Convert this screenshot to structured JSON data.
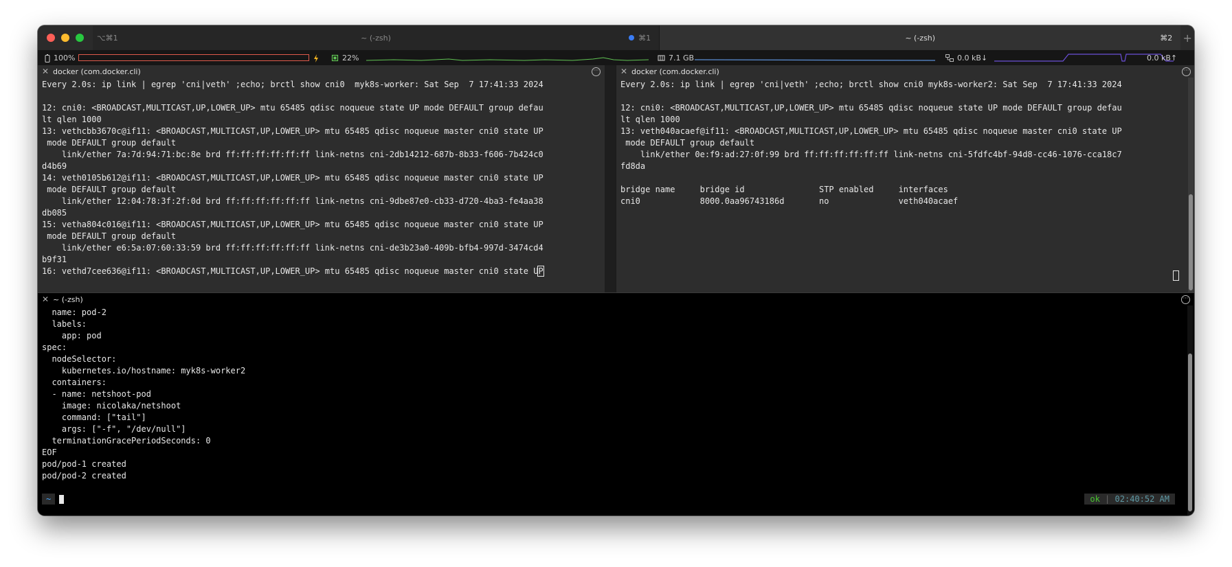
{
  "window": {
    "tabs": [
      {
        "shortcut_left": "⌥⌘1",
        "title": "~ (-zsh)",
        "shortcut_right": "⌘1"
      },
      {
        "title": "~ (-zsh)",
        "shortcut_right": "⌘2"
      }
    ],
    "new_tab": "+"
  },
  "status_bar": {
    "battery": "100%",
    "cpu": "22%",
    "memory": "7.1 GB",
    "net_down": "0.0 kB↓",
    "net_up": "0.0 kB↑",
    "colors": {
      "battery_bar": "#e05a4b",
      "cpu_graph": "#61c454",
      "mem_graph": "#5b8fd6",
      "net_graph": "#6b4fd8"
    }
  },
  "panes": {
    "worker": {
      "title": "docker (com.docker.cli)",
      "lines": [
        "Every 2.0s: ip link | egrep 'cni|veth' ;echo; brctl show cni0  myk8s-worker: Sat Sep  7 17:41:33 2024",
        "",
        "12: cni0: <BROADCAST,MULTICAST,UP,LOWER_UP> mtu 65485 qdisc noqueue state UP mode DEFAULT group defau",
        "lt qlen 1000",
        "13: vethcbb3670c@if11: <BROADCAST,MULTICAST,UP,LOWER_UP> mtu 65485 qdisc noqueue master cni0 state UP",
        " mode DEFAULT group default",
        "    link/ether 7a:7d:94:71:bc:8e brd ff:ff:ff:ff:ff:ff link-netns cni-2db14212-687b-8b33-f606-7b424c0",
        "d4b69",
        "14: veth0105b612@if11: <BROADCAST,MULTICAST,UP,LOWER_UP> mtu 65485 qdisc noqueue master cni0 state UP",
        " mode DEFAULT group default",
        "    link/ether 12:04:78:3f:2f:0d brd ff:ff:ff:ff:ff:ff link-netns cni-9dbe87e0-cb33-d720-4ba3-fe4aa38",
        "db085",
        "15: vetha804c016@if11: <BROADCAST,MULTICAST,UP,LOWER_UP> mtu 65485 qdisc noqueue master cni0 state UP",
        " mode DEFAULT group default",
        "    link/ether e6:5a:07:60:33:59 brd ff:ff:ff:ff:ff:ff link-netns cni-de3b23a0-409b-bfb4-997d-3474cd4",
        "b9f31"
      ],
      "last_line": "16: vethd7cee636@if11: <BROADCAST,MULTICAST,UP,LOWER_UP> mtu 65485 qdisc noqueue master cni0 state U",
      "last_char": "P"
    },
    "worker2": {
      "title": "docker (com.docker.cli)",
      "lines": [
        "Every 2.0s: ip link | egrep 'cni|veth' ;echo; brctl show cni0 myk8s-worker2: Sat Sep  7 17:41:33 2024",
        "",
        "12: cni0: <BROADCAST,MULTICAST,UP,LOWER_UP> mtu 65485 qdisc noqueue state UP mode DEFAULT group defau",
        "lt qlen 1000",
        "13: veth040acaef@if11: <BROADCAST,MULTICAST,UP,LOWER_UP> mtu 65485 qdisc noqueue master cni0 state UP",
        " mode DEFAULT group default",
        "    link/ether 0e:f9:ad:27:0f:99 brd ff:ff:ff:ff:ff:ff link-netns cni-5fdfc4bf-94d8-cc46-1076-cca18c7",
        "fd8da",
        "",
        "bridge name     bridge id               STP enabled     interfaces",
        "cni0            8000.0aa96743186d       no              veth040acaef"
      ]
    },
    "shell": {
      "title": "~ (-zsh)",
      "lines": [
        "  name: pod-2",
        "  labels:",
        "    app: pod",
        "spec:",
        "  nodeSelector:",
        "    kubernetes.io/hostname: myk8s-worker2",
        "  containers:",
        "  - name: netshoot-pod",
        "    image: nicolaka/netshoot",
        "    command: [\"tail\"]",
        "    args: [\"-f\", \"/dev/null\"]",
        "  terminationGracePeriodSeconds: 0",
        "EOF",
        "pod/pod-1 created",
        "pod/pod-2 created"
      ],
      "prompt": "~",
      "status_ok": "ok",
      "status_sep": "|",
      "status_time": "02:40:52 AM"
    }
  }
}
